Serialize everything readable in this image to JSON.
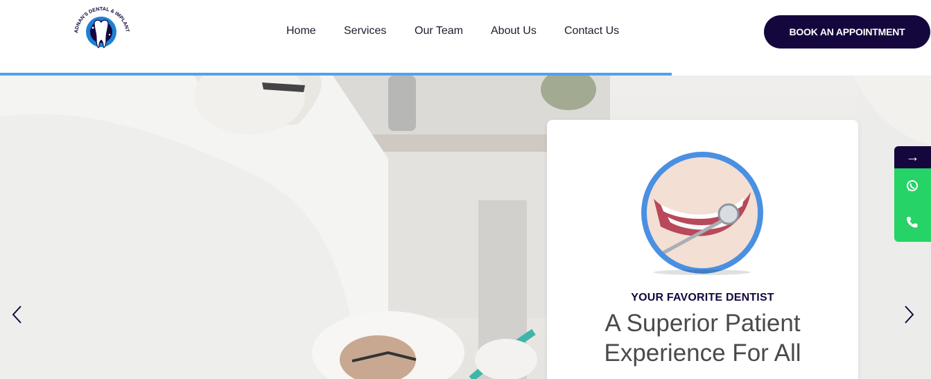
{
  "logo": {
    "text_top": "ADNAN'S DENTAL & IMPLANT CLINIC",
    "icon": "tooth-logo-icon"
  },
  "nav": {
    "items": [
      {
        "label": "Home"
      },
      {
        "label": "Services"
      },
      {
        "label": "Our Team"
      },
      {
        "label": "About Us"
      },
      {
        "label": "Contact Us"
      }
    ]
  },
  "cta": {
    "label": "BOOK AN APPOINTMENT"
  },
  "hero": {
    "subtitle": "YOUR FAVORITE DENTIST",
    "title_line1": "A Superior Patient",
    "title_line2": "Experience For All",
    "prev_icon": "chevron-left-icon",
    "next_icon": "chevron-right-icon"
  },
  "side_widget": {
    "arrow": "→",
    "whatsapp_icon": "whatsapp-icon",
    "phone_icon": "phone-icon"
  },
  "colors": {
    "brand_dark": "#15073d",
    "accent_blue": "#4da3f0",
    "whatsapp_green": "#25d366"
  }
}
